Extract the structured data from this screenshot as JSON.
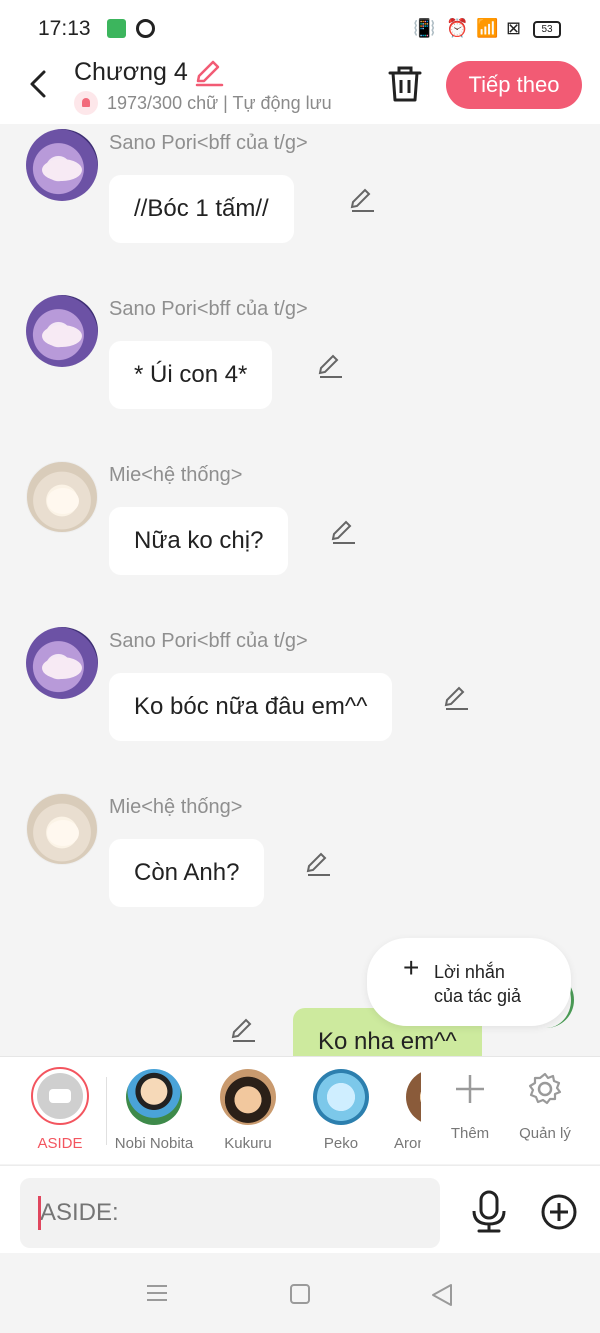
{
  "status": {
    "time": "17:13",
    "battery": "53"
  },
  "header": {
    "title": "Chương 4",
    "subtitle": "1973/300 chữ | Tự động lưu",
    "next_label": "Tiếp theo"
  },
  "messages": [
    {
      "sender": "Sano Pori<bff của t/g>",
      "text": "//Bóc 1 tấm//",
      "avatar": "purple-hair-avatar"
    },
    {
      "sender": "Sano Pori<bff của t/g>",
      "text": "* Úi con 4*",
      "avatar": "purple-hair-avatar"
    },
    {
      "sender": "Mie<hệ thống>",
      "text": "Nữa ko chị?",
      "avatar": "white-hair-avatar"
    },
    {
      "sender": "Sano Pori<bff của t/g>",
      "text": "Ko bóc nữa đâu em^^",
      "avatar": "purple-hair-avatar"
    },
    {
      "sender": "Mie<hệ thống>",
      "text": "Còn Anh?",
      "avatar": "white-hair-avatar"
    }
  ],
  "outgoing": {
    "text": "Ko nha em^^"
  },
  "author_note": {
    "line1": "Lời nhắn",
    "line2": "của tác giả"
  },
  "characters": [
    {
      "name": "ASIDE"
    },
    {
      "name": "Nobi Nobita"
    },
    {
      "name": "Kukuru"
    },
    {
      "name": "Peko"
    },
    {
      "name": "Aron"
    }
  ],
  "actions": {
    "add_label": "Thêm",
    "manage_label": "Quản lý"
  },
  "input": {
    "placeholder": "ASIDE:"
  },
  "colors": {
    "accent": "#f25b74",
    "bubble_out": "#cdea9e",
    "active_ring": "#f3555f"
  }
}
